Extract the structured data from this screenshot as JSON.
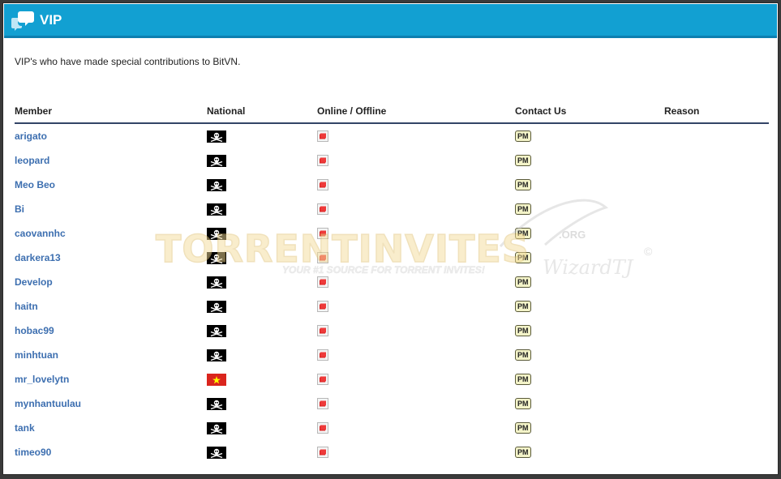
{
  "header": {
    "title": "VIP",
    "icon": "chat-bubbles-icon"
  },
  "intro": "VIP's who have made special contributions to BitVN.",
  "table": {
    "columns": [
      "Member",
      "National",
      "Online / Offline",
      "Contact Us",
      "Reason"
    ],
    "rows": [
      {
        "member": "arigato",
        "national": "pirate-flag-icon",
        "status": "offline-icon",
        "contact": "PM",
        "reason": ""
      },
      {
        "member": "leopard",
        "national": "pirate-flag-icon",
        "status": "offline-icon",
        "contact": "PM",
        "reason": ""
      },
      {
        "member": "Meo Beo",
        "national": "pirate-flag-icon",
        "status": "offline-icon",
        "contact": "PM",
        "reason": ""
      },
      {
        "member": "Bi",
        "national": "pirate-flag-icon",
        "status": "offline-icon",
        "contact": "PM",
        "reason": ""
      },
      {
        "member": "caovannhc",
        "national": "pirate-flag-icon",
        "status": "offline-icon",
        "contact": "PM",
        "reason": ""
      },
      {
        "member": "darkera13",
        "national": "pirate-flag-icon",
        "status": "offline-icon",
        "contact": "PM",
        "reason": ""
      },
      {
        "member": "Develop",
        "national": "pirate-flag-icon",
        "status": "offline-icon",
        "contact": "PM",
        "reason": ""
      },
      {
        "member": "haitn",
        "national": "pirate-flag-icon",
        "status": "offline-icon",
        "contact": "PM",
        "reason": ""
      },
      {
        "member": "hobac99",
        "national": "pirate-flag-icon",
        "status": "offline-icon",
        "contact": "PM",
        "reason": ""
      },
      {
        "member": "minhtuan",
        "national": "pirate-flag-icon",
        "status": "offline-icon",
        "contact": "PM",
        "reason": ""
      },
      {
        "member": "mr_lovelytn",
        "national": "vietnam-flag-icon",
        "status": "offline-icon",
        "contact": "PM",
        "reason": ""
      },
      {
        "member": "mynhantuulau",
        "national": "pirate-flag-icon",
        "status": "offline-icon",
        "contact": "PM",
        "reason": ""
      },
      {
        "member": "tank",
        "national": "pirate-flag-icon",
        "status": "offline-icon",
        "contact": "PM",
        "reason": ""
      },
      {
        "member": "timeo90",
        "national": "pirate-flag-icon",
        "status": "offline-icon",
        "contact": "PM",
        "reason": ""
      }
    ]
  },
  "watermark": {
    "main": "TORRENTINVITES",
    "org": ".ORG",
    "tagline": "YOUR #1 SOURCE FOR TORRENT INVITES!",
    "signature": "WizardTJ",
    "copyright": "©"
  },
  "colors": {
    "header_bg": "#12a0d2",
    "link": "#3d6fb0",
    "header_rule": "#334466",
    "pm_bg": "#f3f3c8",
    "vn_red": "#da251d",
    "vn_star": "#ffff00"
  }
}
